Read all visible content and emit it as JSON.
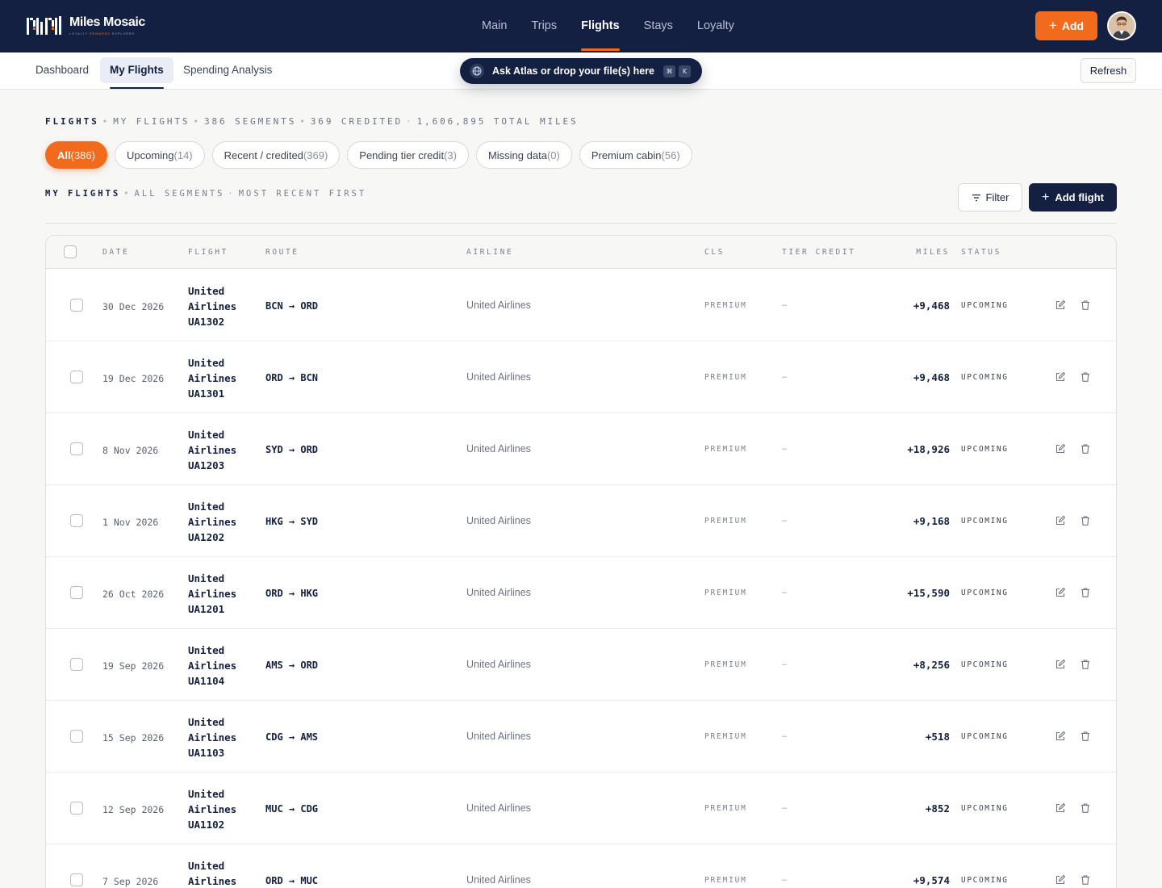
{
  "brand": {
    "name": "Miles Mosaic",
    "tagline_a": "LOYALTY",
    "tagline_b": "REWARDS",
    "tagline_c": "EXPLORER"
  },
  "nav": {
    "items": [
      "Main",
      "Trips",
      "Flights",
      "Stays",
      "Loyalty"
    ],
    "active": "Flights"
  },
  "header": {
    "add_label": "Add"
  },
  "subnav": {
    "tabs": [
      "Dashboard",
      "My Flights",
      "Spending Analysis"
    ],
    "active": "My Flights",
    "refresh_label": "Refresh"
  },
  "atlas": {
    "text": "Ask Atlas or drop your file(s) here",
    "key1": "⌘",
    "key2": "K"
  },
  "summary": {
    "section": "FLIGHTS",
    "view": "MY FLIGHTS",
    "segments": "386 SEGMENTS",
    "credited": "369 CREDITED",
    "miles": "1,606,895 TOTAL MILES"
  },
  "chips": [
    {
      "label": "All",
      "count": "(386)"
    },
    {
      "label": "Upcoming",
      "count": "(14)"
    },
    {
      "label": "Recent / credited",
      "count": "(369)"
    },
    {
      "label": "Pending tier credit",
      "count": "(3)"
    },
    {
      "label": "Missing data",
      "count": "(0)"
    },
    {
      "label": "Premium cabin",
      "count": "(56)"
    }
  ],
  "list": {
    "title": "MY FLIGHTS",
    "scope": "ALL SEGMENTS",
    "sort": "MOST RECENT FIRST",
    "filter_label": "Filter",
    "add_flight_label": "Add flight"
  },
  "table": {
    "columns": {
      "date": "DATE",
      "flight": "FLIGHT",
      "route": "ROUTE",
      "airline": "AIRLINE",
      "cls": "CLS",
      "tier": "TIER CREDIT",
      "miles": "MILES",
      "status": "STATUS"
    },
    "rows": [
      {
        "date": "30 Dec 2026",
        "flight": "United Airlines UA1302",
        "route": "BCN → ORD",
        "airline": "United Airlines",
        "cls": "PREMIUM",
        "tier": "–",
        "miles": "+9,468",
        "status": "UPCOMING"
      },
      {
        "date": "19 Dec 2026",
        "flight": "United Airlines UA1301",
        "route": "ORD → BCN",
        "airline": "United Airlines",
        "cls": "PREMIUM",
        "tier": "–",
        "miles": "+9,468",
        "status": "UPCOMING"
      },
      {
        "date": "8 Nov 2026",
        "flight": "United Airlines UA1203",
        "route": "SYD → ORD",
        "airline": "United Airlines",
        "cls": "PREMIUM",
        "tier": "–",
        "miles": "+18,926",
        "status": "UPCOMING"
      },
      {
        "date": "1 Nov 2026",
        "flight": "United Airlines UA1202",
        "route": "HKG → SYD",
        "airline": "United Airlines",
        "cls": "PREMIUM",
        "tier": "–",
        "miles": "+9,168",
        "status": "UPCOMING"
      },
      {
        "date": "26 Oct 2026",
        "flight": "United Airlines UA1201",
        "route": "ORD → HKG",
        "airline": "United Airlines",
        "cls": "PREMIUM",
        "tier": "–",
        "miles": "+15,590",
        "status": "UPCOMING"
      },
      {
        "date": "19 Sep 2026",
        "flight": "United Airlines UA1104",
        "route": "AMS → ORD",
        "airline": "United Airlines",
        "cls": "PREMIUM",
        "tier": "–",
        "miles": "+8,256",
        "status": "UPCOMING"
      },
      {
        "date": "15 Sep 2026",
        "flight": "United Airlines UA1103",
        "route": "CDG → AMS",
        "airline": "United Airlines",
        "cls": "PREMIUM",
        "tier": "–",
        "miles": "+518",
        "status": "UPCOMING"
      },
      {
        "date": "12 Sep 2026",
        "flight": "United Airlines UA1102",
        "route": "MUC → CDG",
        "airline": "United Airlines",
        "cls": "PREMIUM",
        "tier": "–",
        "miles": "+852",
        "status": "UPCOMING"
      },
      {
        "date": "7 Sep 2026",
        "flight": "United Airlines UA1101",
        "route": "ORD → MUC",
        "airline": "United Airlines",
        "cls": "PREMIUM",
        "tier": "–",
        "miles": "+9,574",
        "status": "UPCOMING"
      }
    ]
  },
  "colors": {
    "navy": "#142041",
    "accent": "#f26b1d",
    "background": "#f7f7f6"
  }
}
